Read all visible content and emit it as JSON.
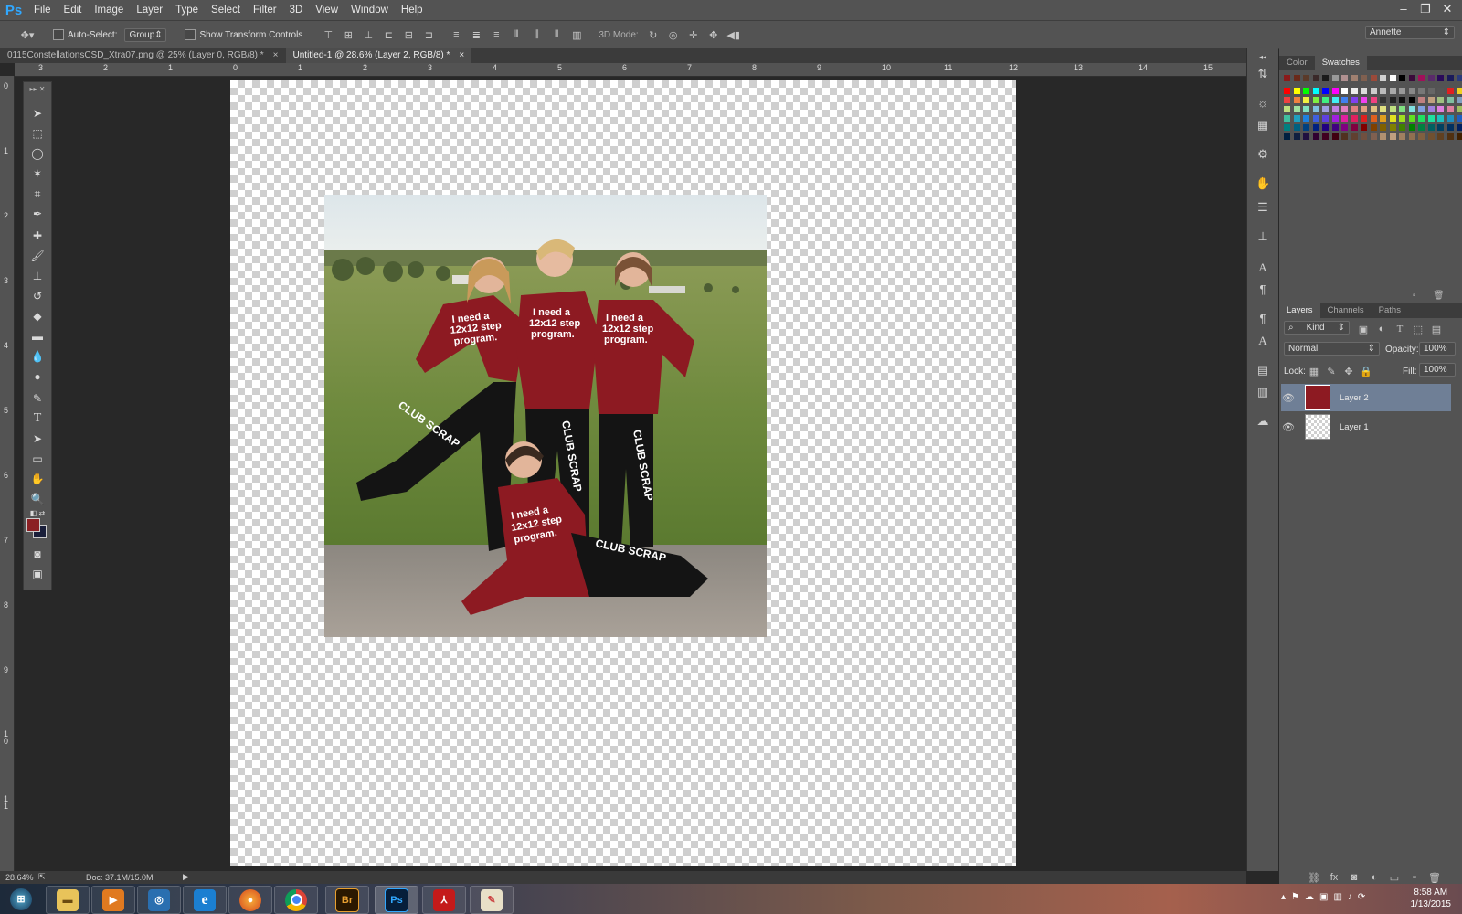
{
  "app": {
    "logo": "Ps"
  },
  "menu": [
    "File",
    "Edit",
    "Image",
    "Layer",
    "Type",
    "Select",
    "Filter",
    "3D",
    "View",
    "Window",
    "Help"
  ],
  "window_controls": {
    "minimize": "–",
    "restore": "❐",
    "close": "✕"
  },
  "options": {
    "auto_select_label": "Auto-Select:",
    "auto_select_value": "Group",
    "transform_label": "Show Transform Controls",
    "mode_label": "3D Mode:",
    "workspace": "Annette"
  },
  "tabs": [
    {
      "label": "0115ConstellationsCSD_Xtra07.png @ 25% (Layer 0, RGB/8) *",
      "close": "×"
    },
    {
      "label": "Untitled-1 @ 28.6% (Layer 2, RGB/8) *",
      "close": "×"
    }
  ],
  "ruler_h": [
    "3",
    "2",
    "1",
    "0",
    "1",
    "2",
    "3",
    "4",
    "5",
    "6",
    "7",
    "8",
    "9",
    "10",
    "11",
    "12",
    "13",
    "14",
    "15"
  ],
  "ruler_v": [
    "0",
    "1",
    "2",
    "3",
    "4",
    "5",
    "6",
    "7",
    "8",
    "9",
    "1 0",
    "1 1"
  ],
  "status": {
    "zoom": "28.64%",
    "doc": "Doc: 37.1M/15.0M"
  },
  "colors": {
    "foreground": "#8b2024",
    "background": "#1a1f3a"
  },
  "photo": {
    "shirt_text_1": "❝I need a 12x12 step program.❞",
    "pants_text": "CLUB SCRAP"
  },
  "color_panel": {
    "tabs": [
      "Color",
      "Swatches"
    ],
    "active": "Swatches"
  },
  "layers_panel": {
    "tabs": [
      "Layers",
      "Channels",
      "Paths"
    ],
    "filter": "Kind",
    "blend_mode": "Normal",
    "opacity_label": "Opacity:",
    "opacity_value": "100%",
    "lock_label": "Lock:",
    "fill_label": "Fill:",
    "fill_value": "100%",
    "layers": [
      {
        "name": "Layer 2",
        "selected": true
      },
      {
        "name": "Layer 1",
        "selected": false
      }
    ]
  },
  "taskbar": {
    "apps": [
      "start",
      "explorer",
      "media",
      "network",
      "ie",
      "firefox",
      "chrome",
      "bridge",
      "photoshop",
      "acrobat",
      "paint"
    ],
    "bridge_label": "Br",
    "ps_label": "Ps",
    "time": "8:58 AM",
    "date": "1/13/2015"
  }
}
